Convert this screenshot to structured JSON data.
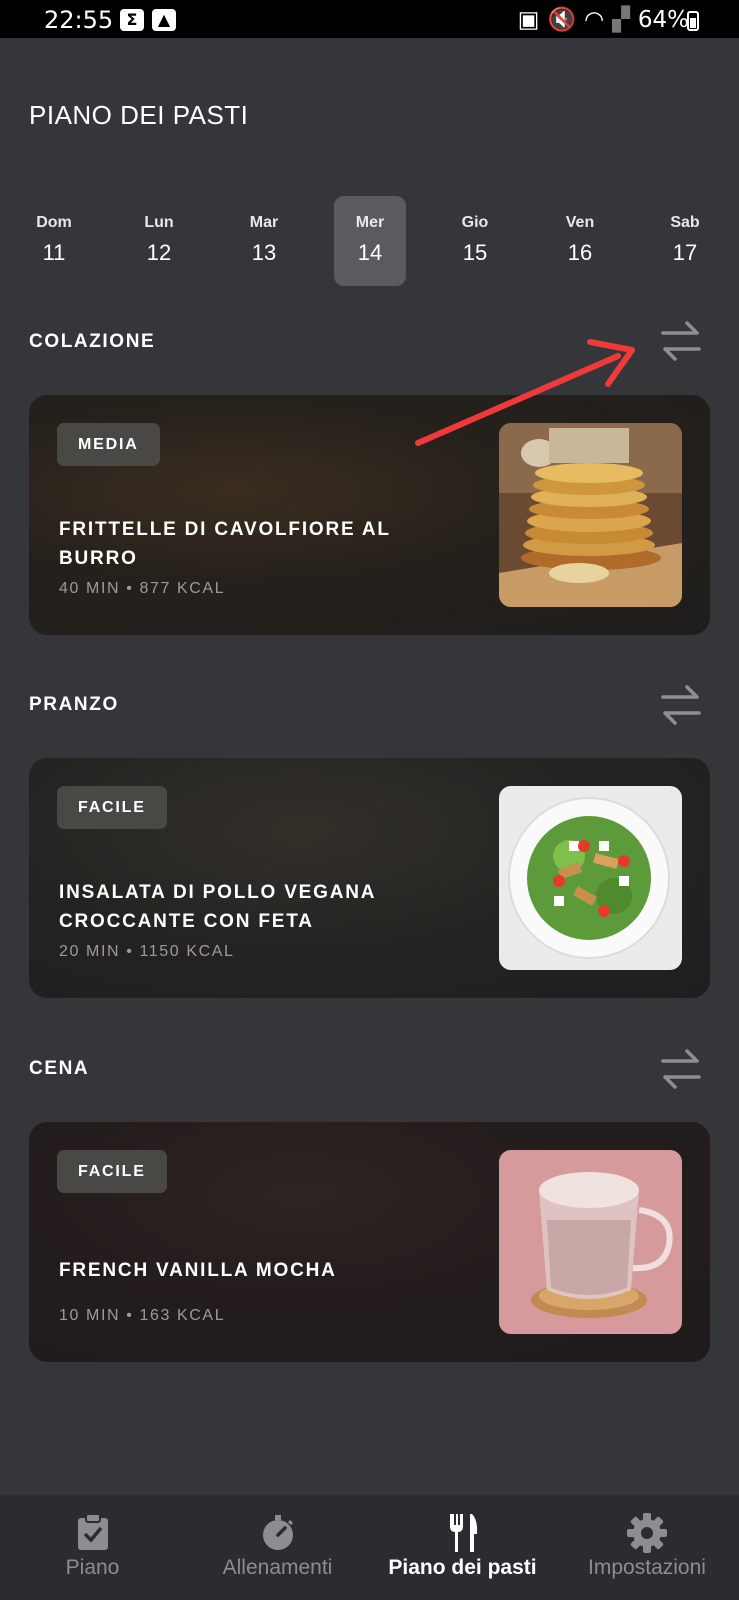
{
  "status_bar": {
    "time": "22:55",
    "battery": "64%"
  },
  "page": {
    "title": "PIANO DEI PASTI"
  },
  "days": [
    {
      "name": "Dom",
      "date": "11",
      "selected": false
    },
    {
      "name": "Lun",
      "date": "12",
      "selected": false
    },
    {
      "name": "Mar",
      "date": "13",
      "selected": false
    },
    {
      "name": "Mer",
      "date": "14",
      "selected": true
    },
    {
      "name": "Gio",
      "date": "15",
      "selected": false
    },
    {
      "name": "Ven",
      "date": "16",
      "selected": false
    },
    {
      "name": "Sab",
      "date": "17",
      "selected": false
    }
  ],
  "meals": [
    {
      "section": "COLAZIONE",
      "difficulty": "MEDIA",
      "name": "FRITTELLE DI CAVOLFIORE AL BURRO",
      "meta": "40 MIN • 877 KCAL"
    },
    {
      "section": "PRANZO",
      "difficulty": "FACILE",
      "name": "INSALATA DI POLLO VEGANA CROCCANTE CON FETA",
      "meta": "20 MIN • 1150 KCAL"
    },
    {
      "section": "CENA",
      "difficulty": "FACILE",
      "name": "FRENCH VANILLA MOCHA",
      "meta": "10 MIN • 163 KCAL"
    }
  ],
  "nav": [
    {
      "label": "Piano",
      "icon": "clipboard-check-icon",
      "active": false
    },
    {
      "label": "Allenamenti",
      "icon": "stopwatch-icon",
      "active": false
    },
    {
      "label": "Piano dei pasti",
      "icon": "fork-knife-icon",
      "active": true
    },
    {
      "label": "Impostazioni",
      "icon": "gear-icon",
      "active": false
    }
  ],
  "colors": {
    "background": "#35363a",
    "selected_day": "#5a5b5f",
    "annotation_arrow": "#f03a3a",
    "nav_inactive": "#8d8d90"
  }
}
